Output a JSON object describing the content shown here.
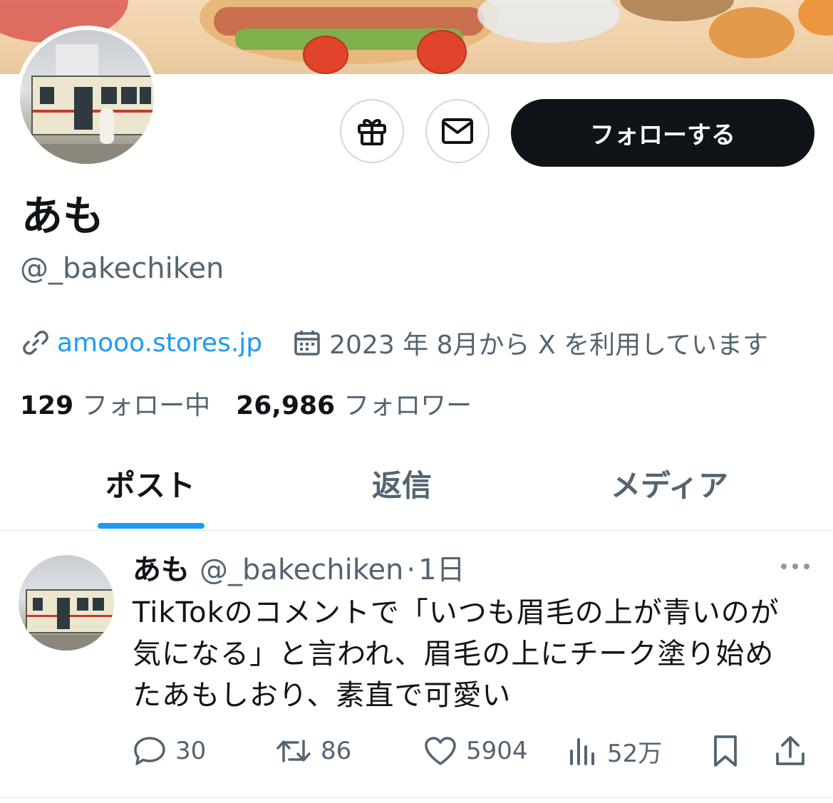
{
  "profile": {
    "name": "あも",
    "handle": "@_bakechiken",
    "website": "amooo.stores.jp",
    "joined": "2023 年 8月から X を利用しています",
    "following_count": "129",
    "following_label": "フォロー中",
    "followers_count": "26,986",
    "followers_label": "フォロワー"
  },
  "actions": {
    "follow_label": "フォローする",
    "gift_icon": "gift-icon",
    "message_icon": "mail-icon"
  },
  "tabs": [
    {
      "label": "ポスト",
      "active": true
    },
    {
      "label": "返信",
      "active": false
    },
    {
      "label": "メディア",
      "active": false
    }
  ],
  "post": {
    "name": "あも",
    "handle": "@_bakechiken",
    "separator": "·",
    "time": "1日",
    "text_line1": "TikTokのコメントで「いつも眉毛の上が青いのが",
    "text_line2": "気になる」と言われ、眉毛の上にチーク塗り始め",
    "text_line3": "たあもしおり、素直で可愛い",
    "replies": "30",
    "reposts": "86",
    "likes": "5904",
    "views": "52万"
  },
  "colors": {
    "accent": "#1d9bf0",
    "text": "#0f1419",
    "muted": "#536471",
    "border": "#cfd9de"
  }
}
